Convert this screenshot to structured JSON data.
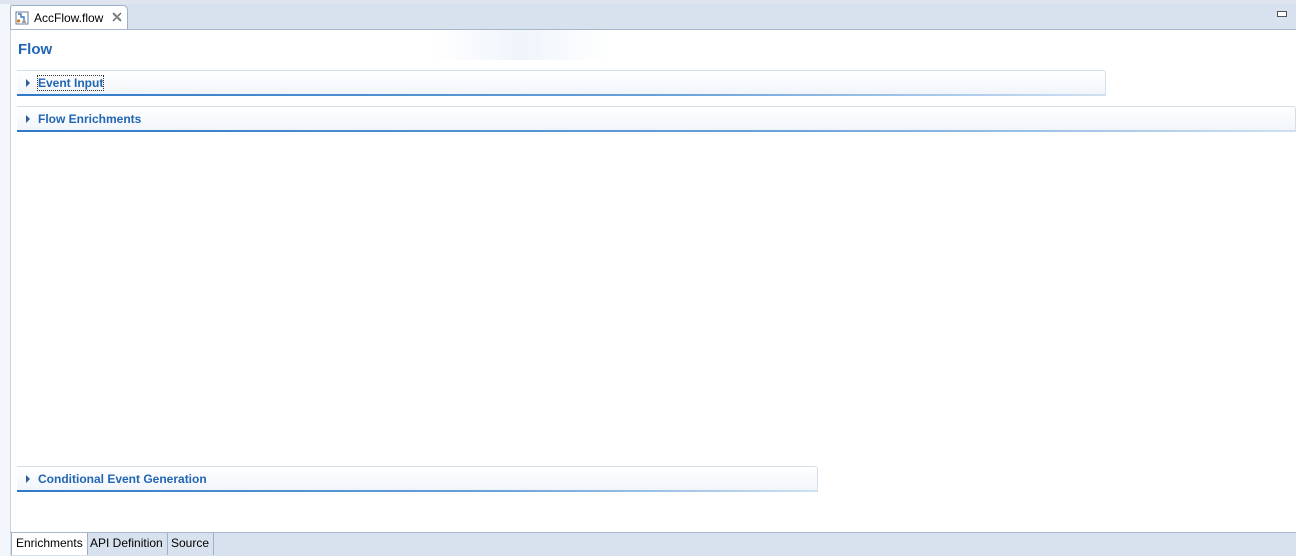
{
  "editor_tab": {
    "label": "AccFlow.flow",
    "icon": "flow-file-icon",
    "close_icon": "close-icon"
  },
  "form": {
    "title": "Flow"
  },
  "sections": {
    "event_input": {
      "label": "Event Input",
      "expanded": false
    },
    "flow_enrichments": {
      "label": "Flow Enrichments",
      "expanded": false
    },
    "conditional_event_generation": {
      "label": "Conditional Event Generation",
      "expanded": false
    }
  },
  "bottom_tabs": [
    {
      "label": "Enrichments",
      "active": true
    },
    {
      "label": "API Definition",
      "active": false
    },
    {
      "label": "Source",
      "active": false
    }
  ],
  "colors": {
    "accent": "#2266b3",
    "tab_bar": "#d8e2ee"
  }
}
